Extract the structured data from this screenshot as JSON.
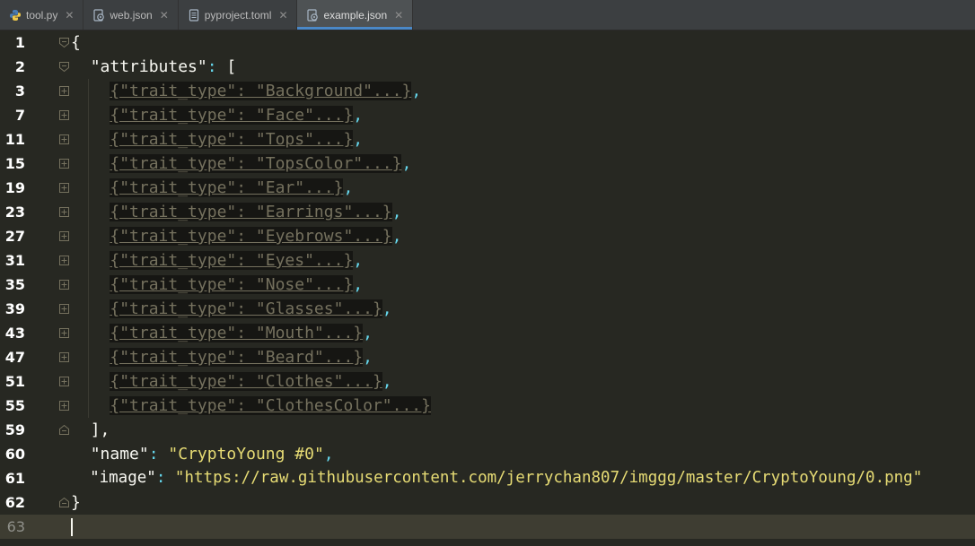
{
  "tabs": [
    {
      "label": "tool.py",
      "icon": "python-file-icon",
      "active": false
    },
    {
      "label": "web.json",
      "icon": "json-file-icon",
      "active": false
    },
    {
      "label": "pyproject.toml",
      "icon": "toml-file-icon",
      "active": false
    },
    {
      "label": "example.json",
      "icon": "json-file-icon",
      "active": true
    }
  ],
  "colors": {
    "background": "#272822",
    "key": "#f8f8f2",
    "string": "#e6db74",
    "punctuation": "#66d9ef",
    "folded": "#75715e",
    "active_tab_underline": "#4a88c7"
  },
  "editor": {
    "lines": [
      {
        "num": "1",
        "text": "{"
      },
      {
        "num": "2",
        "key": "\"attributes\"",
        "rest": "["
      },
      {
        "num": "3",
        "folded": "{\"trait_type\": \"Background\"...}"
      },
      {
        "num": "7",
        "folded": "{\"trait_type\": \"Face\"...}"
      },
      {
        "num": "11",
        "folded": "{\"trait_type\": \"Tops\"...}"
      },
      {
        "num": "15",
        "folded": "{\"trait_type\": \"TopsColor\"...}"
      },
      {
        "num": "19",
        "folded": "{\"trait_type\": \"Ear\"...}"
      },
      {
        "num": "23",
        "folded": "{\"trait_type\": \"Earrings\"...}"
      },
      {
        "num": "27",
        "folded": "{\"trait_type\": \"Eyebrows\"...}"
      },
      {
        "num": "31",
        "folded": "{\"trait_type\": \"Eyes\"...}"
      },
      {
        "num": "35",
        "folded": "{\"trait_type\": \"Nose\"...}"
      },
      {
        "num": "39",
        "folded": "{\"trait_type\": \"Glasses\"...}"
      },
      {
        "num": "43",
        "folded": "{\"trait_type\": \"Mouth\"...}"
      },
      {
        "num": "47",
        "folded": "{\"trait_type\": \"Beard\"...}"
      },
      {
        "num": "51",
        "folded": "{\"trait_type\": \"Clothes\"...}"
      },
      {
        "num": "55",
        "folded": "{\"trait_type\": \"ClothesColor\"...}"
      },
      {
        "num": "59",
        "text": "],"
      },
      {
        "num": "60",
        "key": "\"name\"",
        "value": "\"CryptoYoung #0\""
      },
      {
        "num": "61",
        "key": "\"image\"",
        "value": "\"https://raw.githubusercontent.com/jerrychan807/imggg/master/CryptoYoung/0.png\""
      },
      {
        "num": "62",
        "text": "}"
      },
      {
        "num": "63",
        "text": ""
      }
    ]
  }
}
